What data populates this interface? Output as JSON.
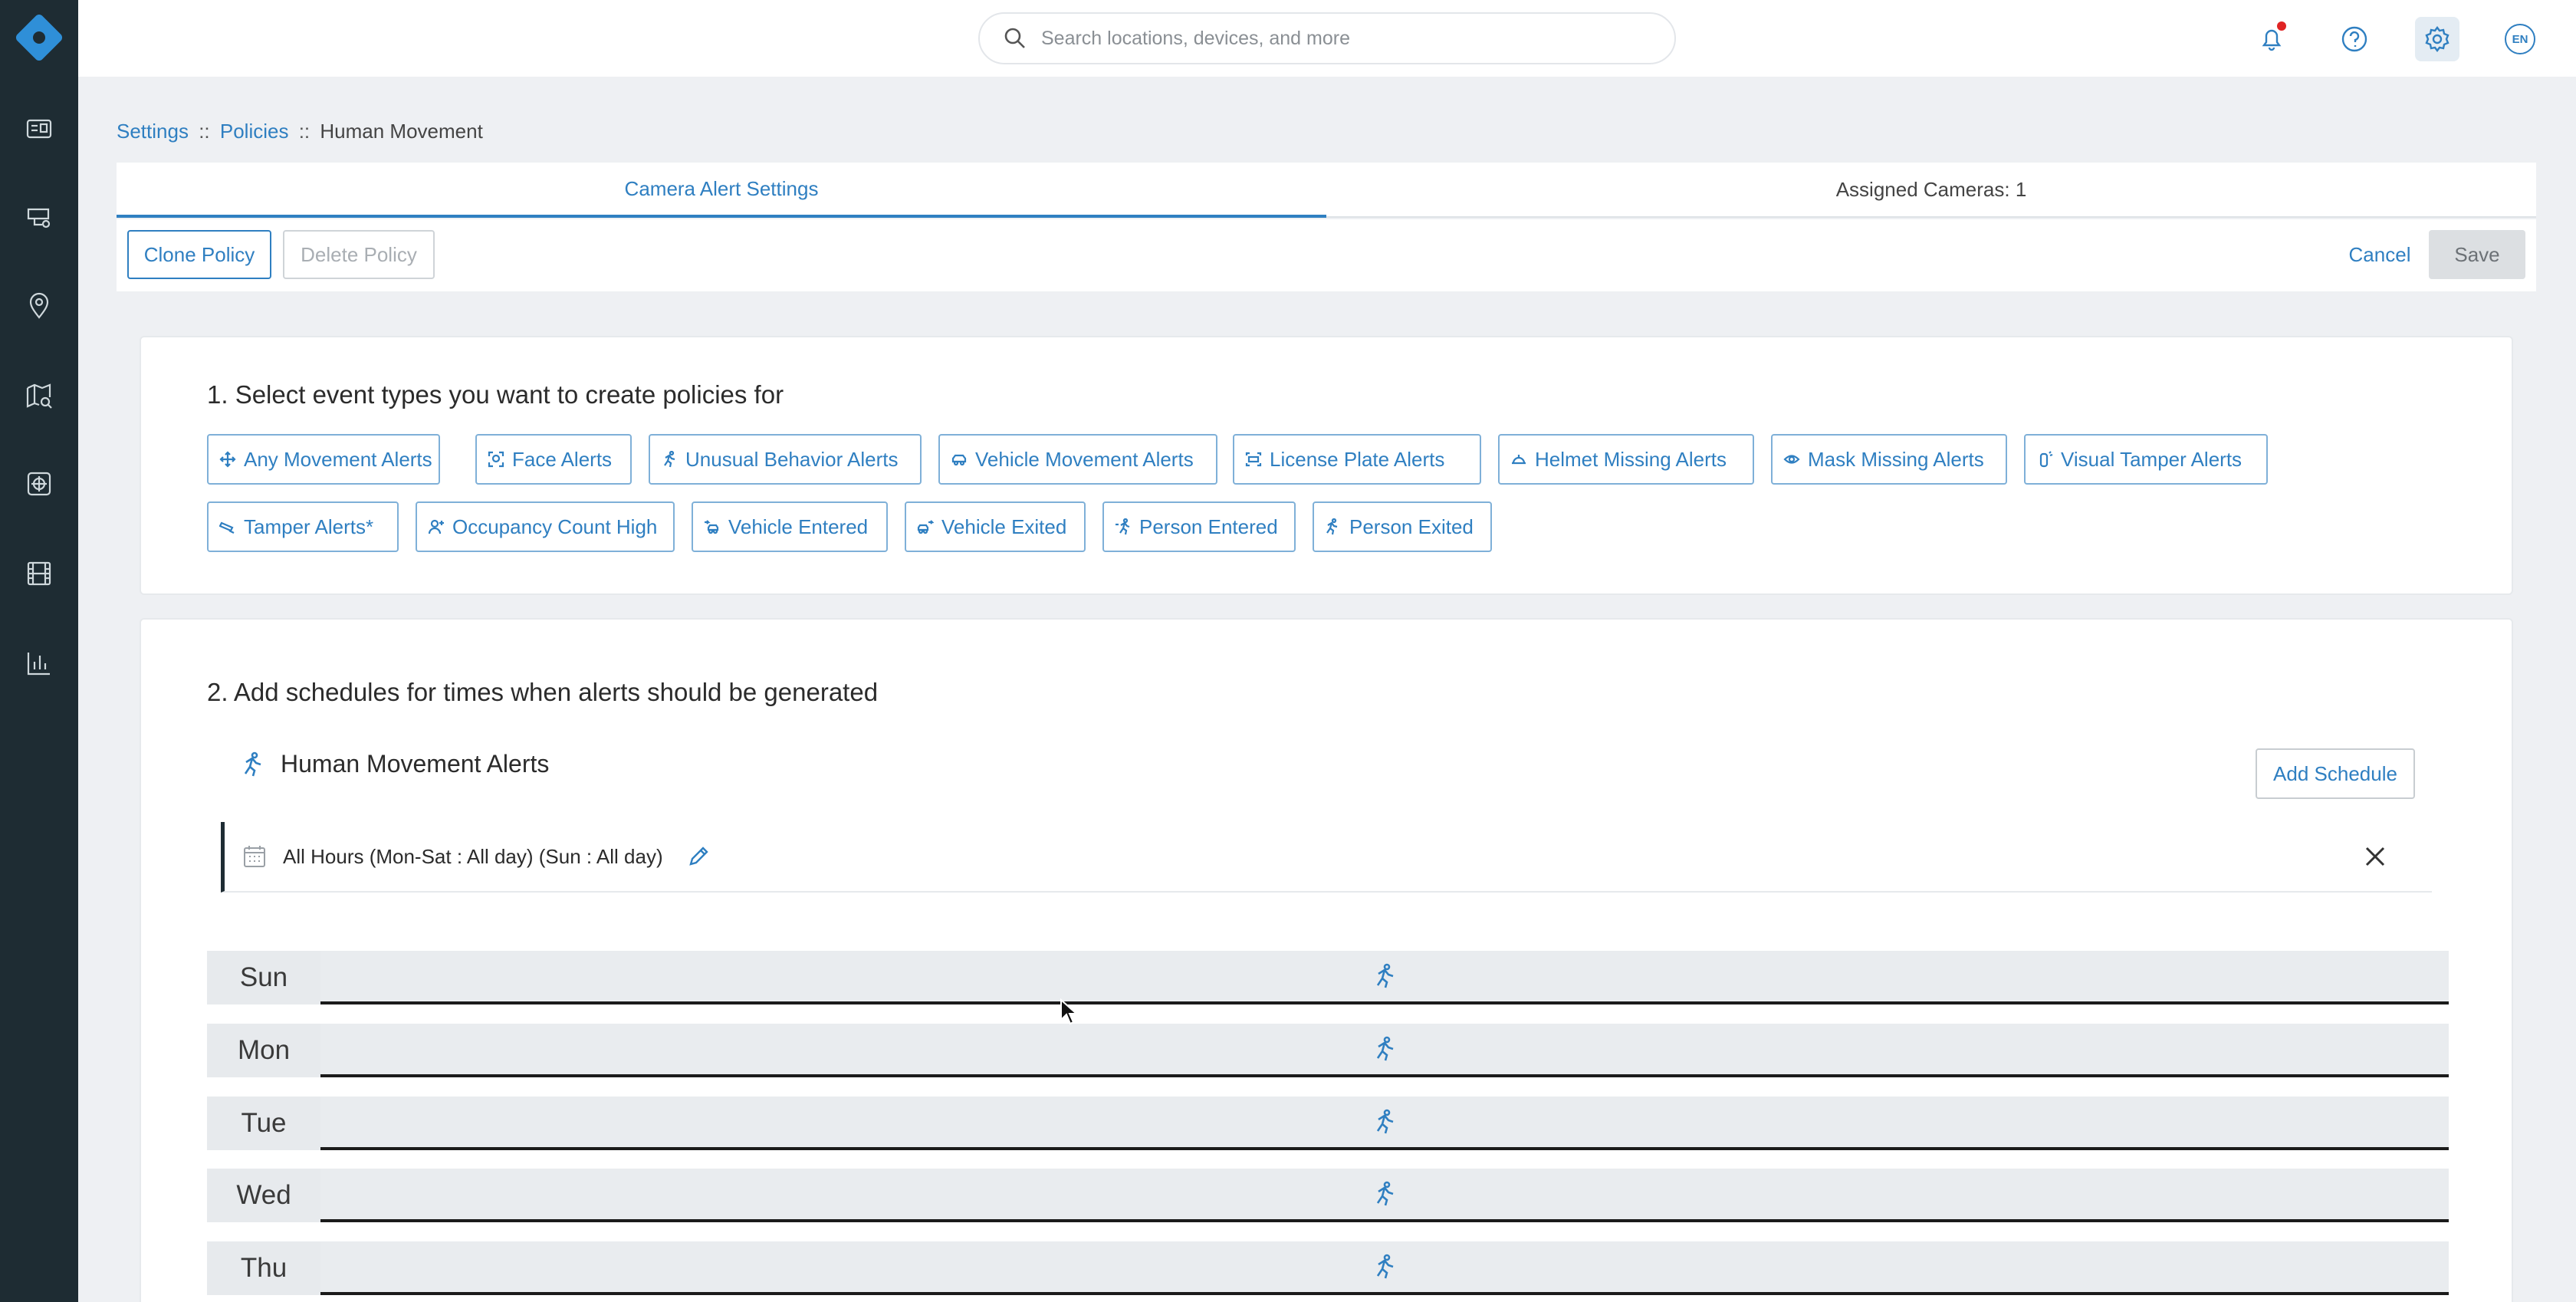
{
  "topbar": {
    "search_placeholder": "Search locations, devices, and more",
    "language": "EN"
  },
  "sidebar": {
    "items": [
      {
        "icon": "dashboard-icon"
      },
      {
        "icon": "camera-icon"
      },
      {
        "icon": "location-pin-icon"
      },
      {
        "icon": "map-search-icon"
      },
      {
        "icon": "policy-icon"
      },
      {
        "icon": "film-icon"
      },
      {
        "icon": "bar-chart-icon"
      }
    ]
  },
  "breadcrumb": {
    "settings": "Settings",
    "sep1": "::",
    "policies": "Policies",
    "sep2": "::",
    "current": "Human Movement"
  },
  "tabs": [
    {
      "label": "Camera Alert Settings",
      "active": true
    },
    {
      "label": "Assigned Cameras: 1",
      "active": false
    }
  ],
  "actions": {
    "clone": "Clone Policy",
    "delete": "Delete Policy",
    "cancel": "Cancel",
    "save": "Save"
  },
  "section1": {
    "title": "1. Select event types you want to create policies for",
    "chips": [
      {
        "label": "Any Movement Alerts",
        "icon": "move-icon"
      },
      {
        "label": "Face Alerts",
        "icon": "face-icon"
      },
      {
        "label": "Unusual Behavior Alerts",
        "icon": "running-icon"
      },
      {
        "label": "Vehicle Movement Alerts",
        "icon": "car-icon"
      },
      {
        "label": "License Plate Alerts",
        "icon": "plate-icon"
      },
      {
        "label": "Helmet Missing Alerts",
        "icon": "helmet-icon"
      },
      {
        "label": "Mask Missing Alerts",
        "icon": "eye-icon"
      },
      {
        "label": "Visual Tamper Alerts",
        "icon": "tamper-icon"
      },
      {
        "label": "Tamper Alerts*",
        "icon": "tamper-icon"
      },
      {
        "label": "Occupancy Count High",
        "icon": "person-icon"
      },
      {
        "label": "Vehicle Entered",
        "icon": "car-enter-icon"
      },
      {
        "label": "Vehicle Exited",
        "icon": "car-exit-icon"
      },
      {
        "label": "Person Entered",
        "icon": "person-enter-icon"
      },
      {
        "label": "Person Exited",
        "icon": "person-exit-icon"
      }
    ]
  },
  "section2": {
    "title": "2. Add schedules for times when alerts should be generated",
    "group_title": "Human Movement Alerts",
    "add_schedule": "Add Schedule",
    "schedule_label": "All Hours (Mon-Sat : All day) (Sun : All day)",
    "days": [
      "Sun",
      "Mon",
      "Tue",
      "Wed",
      "Thu"
    ]
  },
  "colors": {
    "accent": "#2f7fc1",
    "sidebar": "#1e2c33",
    "background": "#eef0f3",
    "notification_dot": "#e02424"
  }
}
